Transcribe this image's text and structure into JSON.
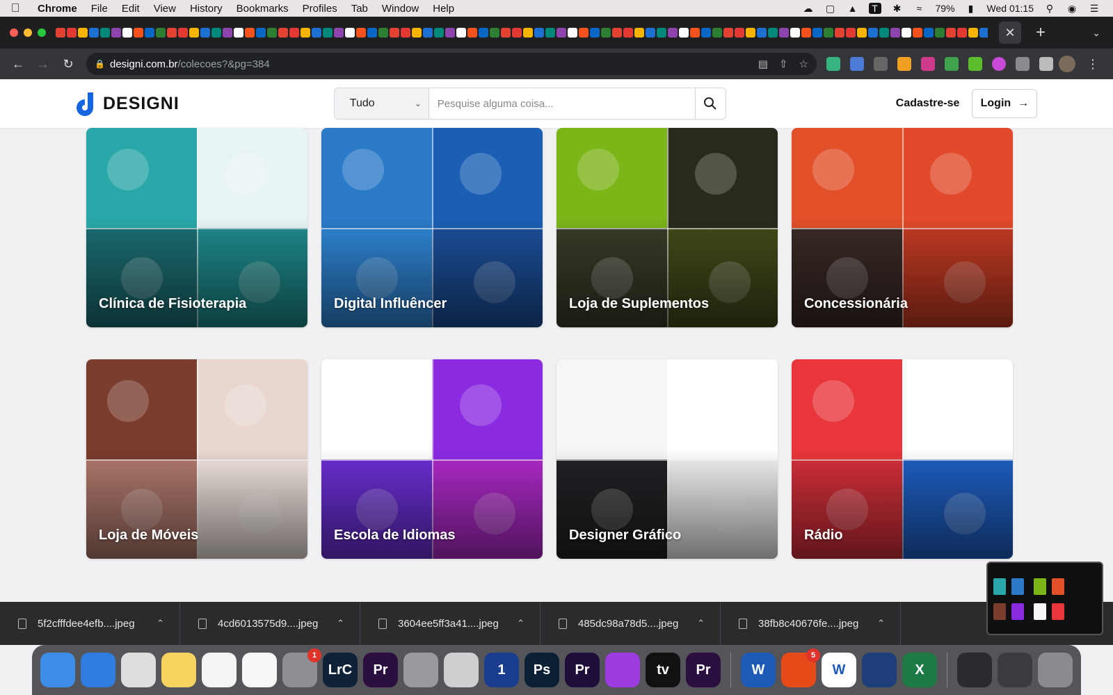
{
  "menubar": {
    "app": "Chrome",
    "items": [
      "File",
      "Edit",
      "View",
      "History",
      "Bookmarks",
      "Profiles",
      "Tab",
      "Window",
      "Help"
    ],
    "battery": "79%",
    "clock": "Wed 01:15"
  },
  "browser": {
    "url_host": "designi.com.br",
    "url_path": "/colecoes?&pg=384"
  },
  "site": {
    "logo_text": "DESIGNI",
    "search_category": "Tudo",
    "search_placeholder": "Pesquise alguma coisa...",
    "signup_label": "Cadastre-se",
    "login_label": "Login"
  },
  "collections": [
    {
      "title": "Clínica de Fisioterapia",
      "colors": [
        "#2aa7a8",
        "#e8f4f4",
        "#1c6e73",
        "#1e8b8d"
      ]
    },
    {
      "title": "Digital Influêncer",
      "colors": [
        "#2b7ac8",
        "#1a5fb4",
        "#2f86d6",
        "#1b4f9a"
      ]
    },
    {
      "title": "Loja de Suplementos",
      "colors": [
        "#7cb518",
        "#2a2a1c",
        "#3b3b2a",
        "#444a1a"
      ]
    },
    {
      "title": "Concessionária",
      "colors": [
        "#e2502a",
        "#e14a2a",
        "#3a2a26",
        "#c63b23"
      ]
    },
    {
      "title": "Loja de Móveis",
      "colors": [
        "#7a3d2e",
        "#e8d6cf",
        "#b27a6e",
        "#f1e5e0"
      ]
    },
    {
      "title": "Escola de Idiomas",
      "colors": [
        "#ffffff",
        "#8a2be2",
        "#6b2fd6",
        "#b02acb"
      ]
    },
    {
      "title": "Designer Gráfico",
      "colors": [
        "#f6f6f8",
        "#ffffff",
        "#222226",
        "#f3f3f6"
      ]
    },
    {
      "title": "Rádio",
      "colors": [
        "#e8363b",
        "#ffffff",
        "#d5303a",
        "#1f5fc4"
      ]
    }
  ],
  "downloads": [
    {
      "name": "5f2cfffdee4efb....jpeg"
    },
    {
      "name": "4cd6013575d9....jpeg"
    },
    {
      "name": "3604ee5ff3a41....jpeg"
    },
    {
      "name": "485dc98a78d5....jpeg"
    },
    {
      "name": "38fb8c40676fe....jpeg"
    }
  ],
  "dock": {
    "apps": [
      {
        "icon": "finder-icon",
        "color": "#3d8ee8",
        "label": ""
      },
      {
        "icon": "safari-icon",
        "color": "#2f7de1",
        "label": ""
      },
      {
        "icon": "chrome-icon",
        "color": "#dedede",
        "label": ""
      },
      {
        "icon": "notes-icon",
        "color": "#f4d35e",
        "label": ""
      },
      {
        "icon": "textedit-icon",
        "color": "#f5f5f5",
        "label": ""
      },
      {
        "icon": "photos-icon",
        "color": "#f7f7f7",
        "label": ""
      },
      {
        "icon": "system-preferences-icon",
        "color": "#8e8e93",
        "label": "",
        "badge": "1"
      },
      {
        "icon": "lightroom-classic-icon",
        "color": "#0f2237",
        "label": "LrC"
      },
      {
        "icon": "premiere-icon",
        "color": "#2a0f40",
        "label": "Pr"
      },
      {
        "icon": "disk-utility-icon",
        "color": "#9a9a9e",
        "label": ""
      },
      {
        "icon": "preview-icon",
        "color": "#cfcfd2",
        "label": ""
      },
      {
        "icon": "onepassword-icon",
        "color": "#1b3d8f",
        "label": "1"
      },
      {
        "icon": "photoshop-icon",
        "color": "#0b1f35",
        "label": "Ps"
      },
      {
        "icon": "premiere-icon-2",
        "color": "#1d0f3a",
        "label": "Pr"
      },
      {
        "icon": "podcasts-icon",
        "color": "#9b3be0",
        "label": ""
      },
      {
        "icon": "apple-tv-icon",
        "color": "#111111",
        "label": "tv"
      },
      {
        "icon": "premiere-icon-3",
        "color": "#2a0f40",
        "label": "Pr"
      },
      {
        "icon": "word-icon",
        "color": "#1e5bb8",
        "label": "W"
      },
      {
        "icon": "office-icon",
        "color": "#e64a19",
        "label": "",
        "badge": "5"
      },
      {
        "icon": "wunderlist-icon",
        "color": "#ffffff",
        "label": "W"
      },
      {
        "icon": "todo-app-icon",
        "color": "#1f3d7a",
        "label": ""
      },
      {
        "icon": "excel-icon",
        "color": "#1d7a44",
        "label": "X"
      }
    ]
  }
}
